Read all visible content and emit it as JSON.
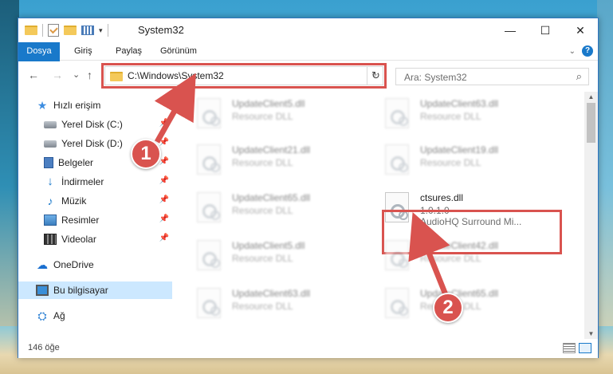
{
  "window": {
    "title": "System32",
    "controls": {
      "minimize": "—",
      "maximize": "☐",
      "close": "✕"
    }
  },
  "ribbon": {
    "tabs": [
      "Dosya",
      "Giriş",
      "Paylaş",
      "Görünüm"
    ],
    "help": "?"
  },
  "address_bar": {
    "path": "C:\\Windows\\System32",
    "dropdown": "⌵",
    "refresh": "↻"
  },
  "search": {
    "placeholder": "Ara: System32"
  },
  "navigation": {
    "back": "←",
    "forward": "→",
    "recent": "⌄",
    "up": "↑",
    "items": [
      {
        "label": "Hızlı erişim",
        "icon": "star-icon",
        "pinned": false
      },
      {
        "label": "Yerel Disk (C:)",
        "icon": "disk-icon",
        "pinned": true
      },
      {
        "label": "Yerel Disk (D:)",
        "icon": "disk-icon",
        "pinned": true
      },
      {
        "label": "Belgeler",
        "icon": "documents-icon",
        "pinned": true
      },
      {
        "label": "İndirmeler",
        "icon": "downloads-icon",
        "pinned": true
      },
      {
        "label": "Müzik",
        "icon": "music-icon",
        "pinned": true
      },
      {
        "label": "Resimler",
        "icon": "pictures-icon",
        "pinned": true
      },
      {
        "label": "Videolar",
        "icon": "videos-icon",
        "pinned": true
      },
      {
        "label": "OneDrive",
        "icon": "onedrive-icon",
        "pinned": false
      },
      {
        "label": "Bu bilgisayar",
        "icon": "this-pc-icon",
        "pinned": false,
        "selected": true
      },
      {
        "label": "Ağ",
        "icon": "network-icon",
        "pinned": false
      }
    ]
  },
  "files": [
    {
      "name": "UpdateClient5.dll",
      "type": "Resource DLL",
      "blurred": true
    },
    {
      "name": "UpdateClient63.dll",
      "type": "Resource DLL",
      "blurred": true
    },
    {
      "name": "UpdateClient21.dll",
      "type": "Resource DLL",
      "blurred": true
    },
    {
      "name": "UpdateClient19.dll",
      "type": "Resource DLL",
      "blurred": true
    },
    {
      "name": "UpdateClient65.dll",
      "type": "Resource DLL",
      "blurred": true
    },
    {
      "name": "ctsures.dll",
      "version": "1.0.1.0",
      "type": "AudioHQ Surround Mi...",
      "blurred": false,
      "highlighted": true
    },
    {
      "name": "UpdateClient5.dll",
      "type": "Resource DLL",
      "blurred": true
    },
    {
      "name": "UpdateClient42.dll",
      "type": "Resource DLL",
      "blurred": true
    },
    {
      "name": "UpdateClient63.dll",
      "type": "Resource DLL",
      "blurred": true
    },
    {
      "name": "UpdateClient65.dll",
      "type": "Resource DLL",
      "blurred": true
    }
  ],
  "status": {
    "count": "146 öğe"
  },
  "callouts": [
    {
      "number": "1"
    },
    {
      "number": "2"
    }
  ],
  "colors": {
    "accent": "#1979ca",
    "callout": "#d9534f",
    "selected": "#cce8ff"
  }
}
